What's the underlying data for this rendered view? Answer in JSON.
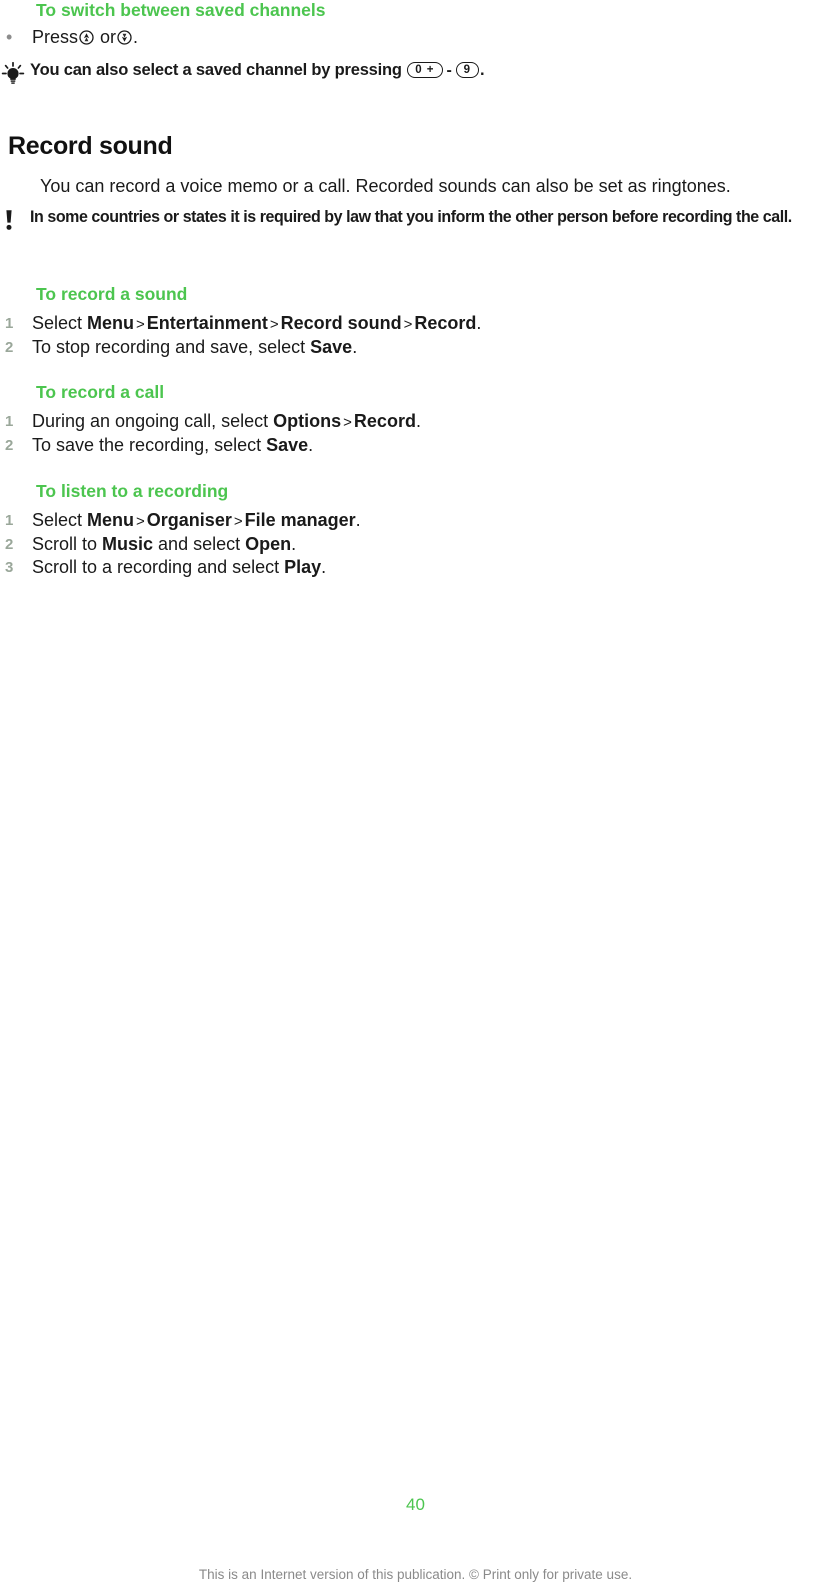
{
  "document": {
    "page_number": "40",
    "footer_note": "This is an Internet version of this publication. © Print only for private use.",
    "accent_green": "#4cc54f",
    "text_color": "#1a1a1a",
    "footer_color": "#8a8a8a"
  },
  "switch_channels": {
    "heading": "To switch between saved channels",
    "bullet_marker": "•",
    "step_prefix": "Press",
    "step_middle": "or",
    "step_suffix": ".",
    "icon_up": "nav-key-up-icon",
    "icon_down": "nav-key-down-icon"
  },
  "tip": {
    "icon": "lightbulb-tip-icon",
    "text_before": "You can also select a saved channel by pressing",
    "key_from": "0 +",
    "separator": "-",
    "key_to": "9",
    "text_after": "."
  },
  "record_sound": {
    "heading": "Record sound",
    "intro": "You can record a voice memo or a call. Recorded sounds can also be set as ringtones.",
    "note": {
      "icon": "exclamation-note-icon",
      "text": "In some countries or states it is required by law that you inform the other person before recording the call."
    }
  },
  "procedures": [
    {
      "heading": "To record a sound",
      "steps": [
        {
          "number": "1",
          "parts": [
            {
              "text": "Select ",
              "style": "normal"
            },
            {
              "text": "Menu",
              "style": "bold"
            },
            {
              "text": ">",
              "style": "gt"
            },
            {
              "text": "Entertainment",
              "style": "bold"
            },
            {
              "text": ">",
              "style": "gt"
            },
            {
              "text": "Record sound",
              "style": "bold"
            },
            {
              "text": ">",
              "style": "gt"
            },
            {
              "text": "Record",
              "style": "bold"
            },
            {
              "text": ".",
              "style": "normal"
            }
          ]
        },
        {
          "number": "2",
          "parts": [
            {
              "text": "To stop recording and save, select ",
              "style": "normal"
            },
            {
              "text": "Save",
              "style": "bold"
            },
            {
              "text": ".",
              "style": "normal"
            }
          ]
        }
      ]
    },
    {
      "heading": "To record a call",
      "steps": [
        {
          "number": "1",
          "parts": [
            {
              "text": "During an ongoing call, select ",
              "style": "normal"
            },
            {
              "text": "Options",
              "style": "bold"
            },
            {
              "text": ">",
              "style": "gt"
            },
            {
              "text": "Record",
              "style": "bold"
            },
            {
              "text": ".",
              "style": "normal"
            }
          ]
        },
        {
          "number": "2",
          "parts": [
            {
              "text": "To save the recording, select ",
              "style": "normal"
            },
            {
              "text": "Save",
              "style": "bold"
            },
            {
              "text": ".",
              "style": "normal"
            }
          ]
        }
      ]
    },
    {
      "heading": "To listen to a recording",
      "steps": [
        {
          "number": "1",
          "parts": [
            {
              "text": "Select ",
              "style": "normal"
            },
            {
              "text": "Menu",
              "style": "bold"
            },
            {
              "text": ">",
              "style": "gt"
            },
            {
              "text": "Organiser",
              "style": "bold"
            },
            {
              "text": ">",
              "style": "gt"
            },
            {
              "text": "File manager",
              "style": "bold"
            },
            {
              "text": ".",
              "style": "normal"
            }
          ]
        },
        {
          "number": "2",
          "parts": [
            {
              "text": "Scroll to ",
              "style": "normal"
            },
            {
              "text": "Music",
              "style": "bold"
            },
            {
              "text": " and select ",
              "style": "normal"
            },
            {
              "text": "Open",
              "style": "bold"
            },
            {
              "text": ".",
              "style": "normal"
            }
          ]
        },
        {
          "number": "3",
          "parts": [
            {
              "text": "Scroll to a recording and select ",
              "style": "normal"
            },
            {
              "text": "Play",
              "style": "bold"
            },
            {
              "text": ".",
              "style": "normal"
            }
          ]
        }
      ]
    }
  ]
}
